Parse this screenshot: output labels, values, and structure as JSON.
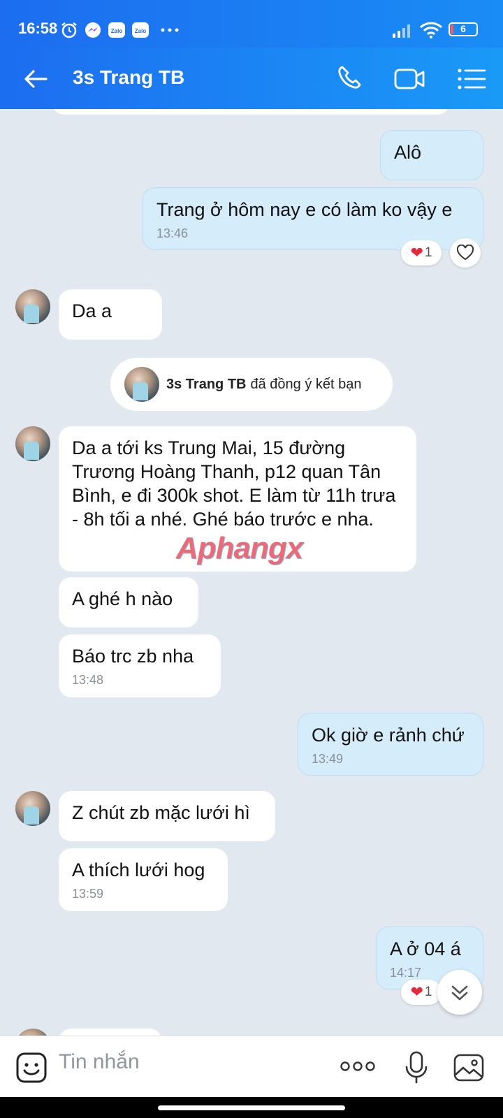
{
  "status": {
    "time": "16:58",
    "battery": "6",
    "app_icons": [
      "alarm-icon",
      "messenger-icon",
      "zalo-icon",
      "zalo-icon",
      "more-dots-icon"
    ]
  },
  "header": {
    "title": "3s Trang TB",
    "icons": [
      "back-arrow-icon",
      "phone-icon",
      "video-call-icon",
      "menu-list-icon"
    ]
  },
  "messages": {
    "m1": {
      "text": "Alô"
    },
    "m2": {
      "text": "Trang ở hôm nay e có làm ko vậy e",
      "time": "13:46",
      "reaction_count": "1"
    },
    "m3": {
      "text": "Da a"
    },
    "system": {
      "name": "3s Trang TB",
      "text": "đã đồng ý kết bạn"
    },
    "m4": {
      "text": "Da a tới ks Trung Mai, 15 đường Trương Hoàng Thanh, p12 quan Tân Bình, e đi 300k shot. E làm từ 11h trưa - 8h tối a nhé. Ghé báo trước e nha."
    },
    "m5": {
      "text": "A ghé h nào"
    },
    "m6": {
      "text": "Báo trc zb nha",
      "time": "13:48"
    },
    "m7": {
      "text": "Ok giờ e rảnh chứ",
      "time": "13:49"
    },
    "m8": {
      "text": "Z chút zb mặc lưới hì"
    },
    "m9": {
      "text": "A thích lưới hog",
      "time": "13:59"
    },
    "m10": {
      "text": "A ở 04 á",
      "time": "14:17",
      "reaction_count": "1"
    }
  },
  "watermark": "Aphangx",
  "input": {
    "placeholder": "Tin nhắn"
  },
  "colors": {
    "header": "#1c6df0",
    "outgoing_bubble": "#d5ecfb",
    "incoming_bubble": "#ffffff",
    "background": "#e2e8ef",
    "heart": "#e5283c"
  }
}
